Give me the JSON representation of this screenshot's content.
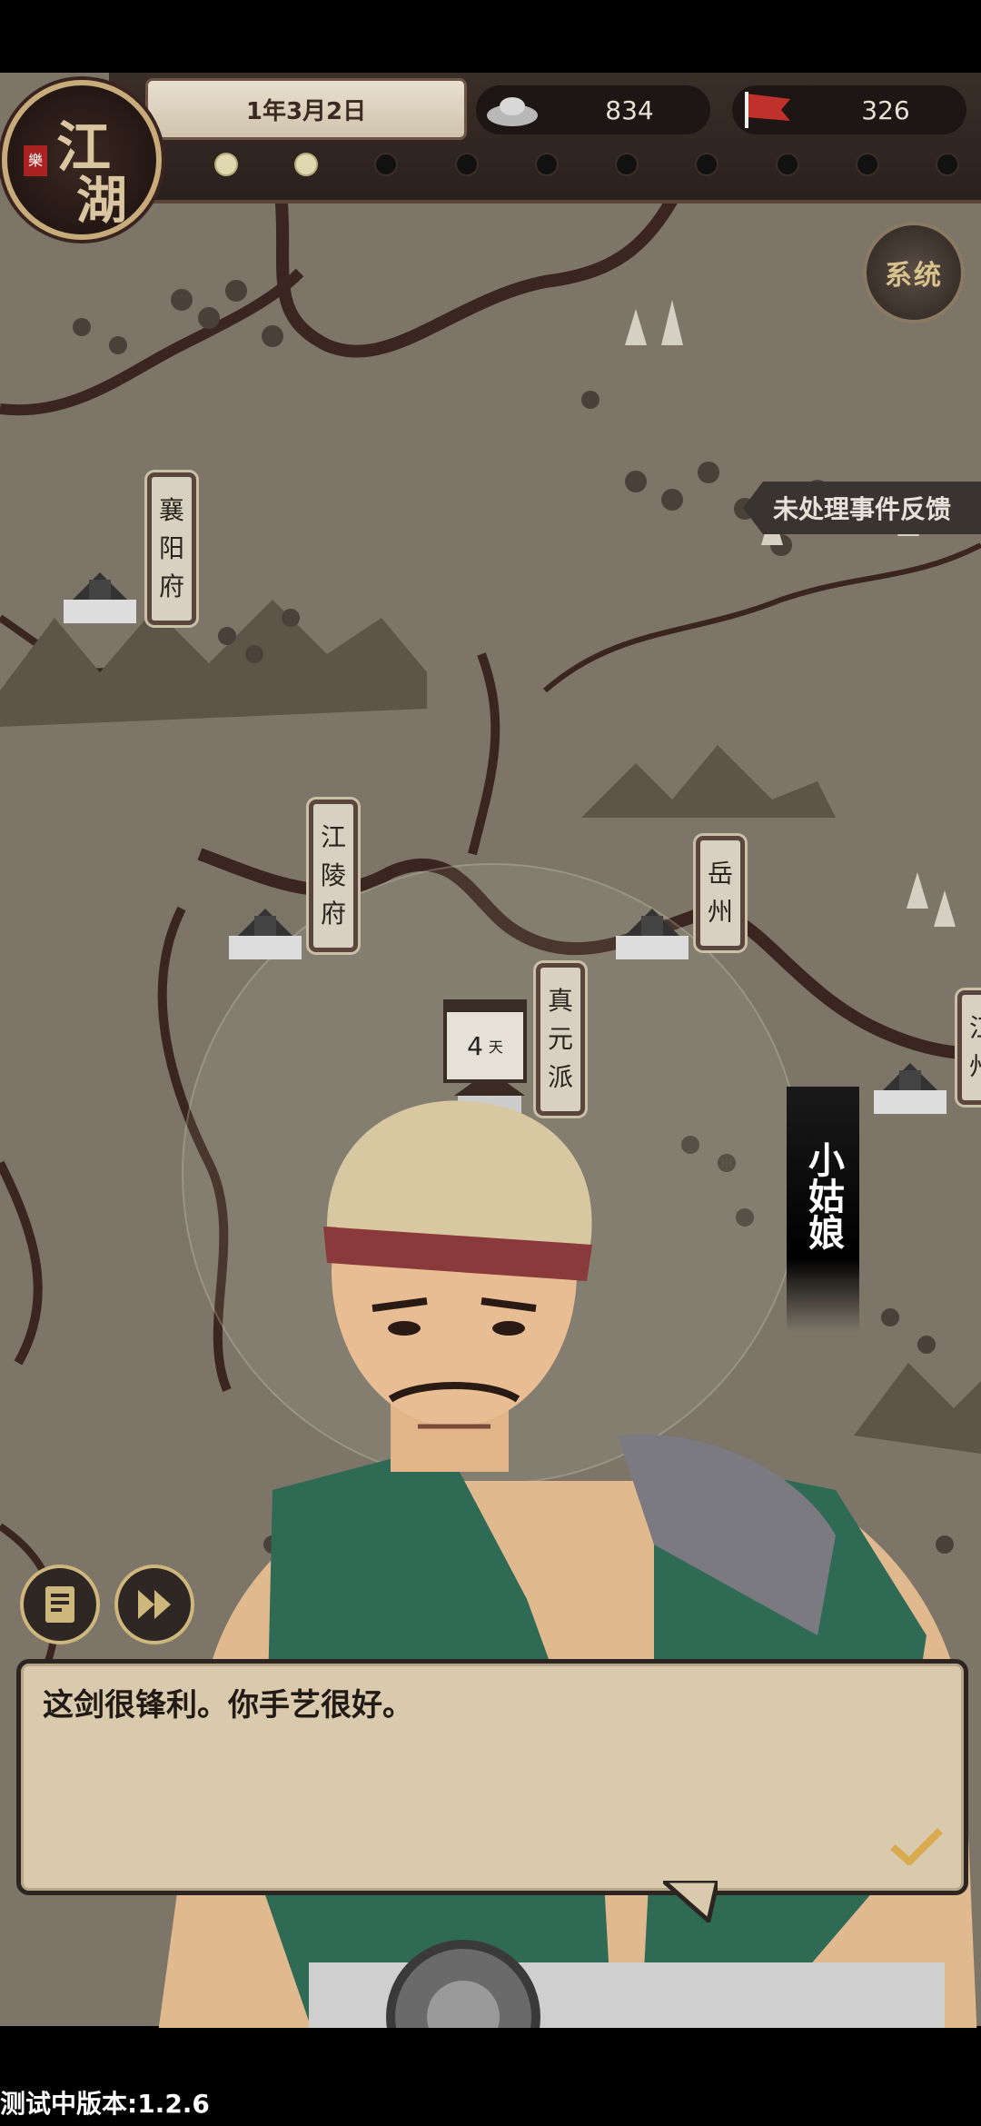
{
  "hud": {
    "date": "1年3月2日",
    "silver": "834",
    "reputation": "326",
    "progress_dots": [
      true,
      true,
      false,
      false,
      false,
      false,
      false,
      false,
      false,
      false
    ],
    "system_label": "系统"
  },
  "logo": {
    "line1": "江",
    "line2": "湖",
    "seal": "樂"
  },
  "event_feedback_label": "未处理事件反馈",
  "locations": {
    "xiangyang": "襄阳府",
    "jiangling": "江陵府",
    "yuezhou": "岳州",
    "zhenyuan": "真元派",
    "jiangzhou": "江州"
  },
  "travel_days": {
    "value": "4",
    "unit": "天"
  },
  "speaker_name": "小姑娘",
  "dialog": {
    "text": "这剑很锋利。你手艺很好。"
  },
  "version": "测试中版本:1.2.6",
  "colors": {
    "map_bg": "#7c7568",
    "river": "#3a2520",
    "dialog_bg": "#d9c9ad",
    "accent_gold": "#cdb77d"
  }
}
